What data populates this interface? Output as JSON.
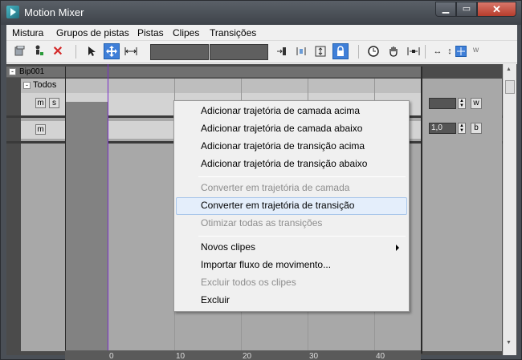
{
  "window": {
    "title": "Motion Mixer",
    "close_glyph": "✕",
    "min_glyph": "▁",
    "max_glyph": "▭"
  },
  "menu": [
    "Mistura",
    "Grupos de pistas",
    "Pistas",
    "Clipes",
    "Transições"
  ],
  "toolbar": {
    "icons": [
      "add-biped-icon",
      "add-character-icon",
      "delete-icon",
      "select-arrow-icon",
      "move-icon",
      "scale-icon",
      "set-range-icon",
      "trim-icon",
      "fit-icon",
      "lock-icon",
      "time-icon",
      "pan-icon",
      "zoom-extents-icon",
      "zoom-horizontal-icon",
      "zoom-vertical-icon",
      "zoom-region-icon"
    ],
    "trailing_w": "w"
  },
  "mixer": {
    "bip_label": "Bip001",
    "group_label": "Todos",
    "track1_buttons": [
      "m",
      "s"
    ],
    "track2_buttons": [
      "m"
    ],
    "track1_value": "",
    "track1_btn": "w",
    "track2_value": "1,0",
    "track2_btn": "b",
    "expander_glyph": "-",
    "ruler_ticks": [
      "0",
      "10",
      "20",
      "30",
      "40"
    ]
  },
  "context_menu": {
    "groups": [
      [
        {
          "label": "Adicionar trajetória de camada acima",
          "enabled": true
        },
        {
          "label": "Adicionar trajetória de camada abaixo",
          "enabled": true
        },
        {
          "label": "Adicionar trajetória de transição acima",
          "enabled": true
        },
        {
          "label": "Adicionar trajetória de transição abaixo",
          "enabled": true
        }
      ],
      [
        {
          "label": "Converter em trajetória de camada",
          "enabled": false
        },
        {
          "label": "Converter em trajetória de transição",
          "enabled": true,
          "highlighted": true
        },
        {
          "label": "Otimizar todas as transições",
          "enabled": false
        }
      ],
      [
        {
          "label": "Novos clipes",
          "enabled": true,
          "submenu": true
        },
        {
          "label": "Importar fluxo de movimento...",
          "enabled": true
        },
        {
          "label": "Excluir todos os clipes",
          "enabled": false
        },
        {
          "label": "Excluir",
          "enabled": true
        }
      ]
    ]
  },
  "colors": {
    "accent": "#3f7fd8",
    "cursor": "#7a2ec8",
    "highlight": "#e4eefb"
  }
}
